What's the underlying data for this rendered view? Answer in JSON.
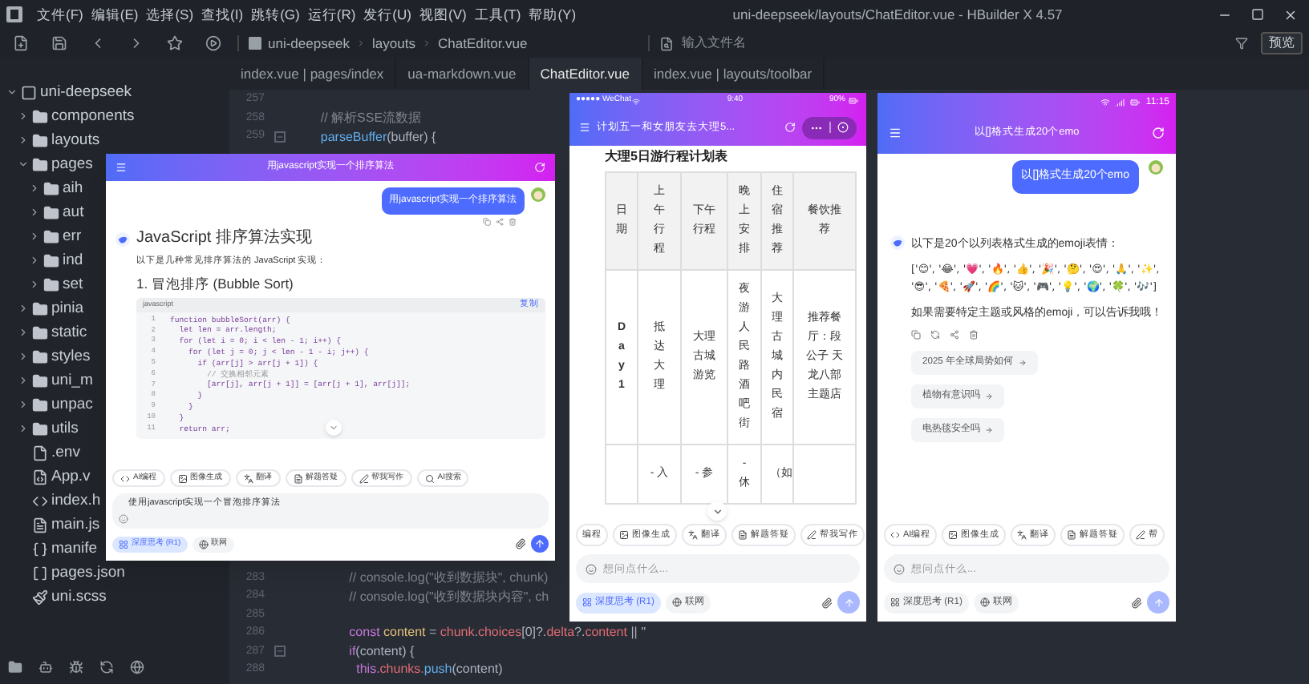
{
  "title_bar": {
    "menus": [
      "文件(F)",
      "编辑(E)",
      "选择(S)",
      "查找(I)",
      "跳转(G)",
      "运行(R)",
      "发行(U)",
      "视图(V)",
      "工具(T)",
      "帮助(Y)"
    ],
    "title": "uni-deepseek/layouts/ChatEditor.vue - HBuilder X 4.57"
  },
  "toolbar": {
    "breadcrumb": [
      "uni-deepseek",
      "layouts",
      "ChatEditor.vue"
    ],
    "file_search": {
      "placeholder": "输入文件名"
    },
    "preview_button": "预览"
  },
  "file_tree": [
    {
      "name": "uni-deepseek",
      "kind": "project",
      "expanded": true,
      "children": [
        {
          "name": "components",
          "kind": "folder",
          "expanded": false
        },
        {
          "name": "layouts",
          "kind": "folder",
          "expanded": false
        },
        {
          "name": "pages",
          "kind": "folder",
          "expanded": true,
          "children": [
            {
              "name": "aih",
              "kind": "folder",
              "expanded": false
            },
            {
              "name": "aut",
              "kind": "folder",
              "expanded": false
            },
            {
              "name": "err",
              "kind": "folder",
              "expanded": false
            },
            {
              "name": "ind",
              "kind": "folder",
              "expanded": false
            },
            {
              "name": "set",
              "kind": "folder",
              "expanded": false
            }
          ]
        },
        {
          "name": "pinia",
          "kind": "folder",
          "expanded": false
        },
        {
          "name": "static",
          "kind": "folder",
          "expanded": false
        },
        {
          "name": "styles",
          "kind": "folder",
          "expanded": false
        },
        {
          "name": "uni_m",
          "kind": "folder",
          "expanded": false
        },
        {
          "name": "unpac",
          "kind": "folder",
          "expanded": false
        },
        {
          "name": "utils",
          "kind": "folder",
          "expanded": false
        },
        {
          "name": ".env",
          "kind": "file"
        },
        {
          "name": "App.v",
          "kind": "vue"
        },
        {
          "name": "index.h",
          "kind": "html"
        },
        {
          "name": "main.js",
          "kind": "js"
        },
        {
          "name": "manife",
          "kind": "manifest"
        },
        {
          "name": "pages.json",
          "kind": "json"
        },
        {
          "name": "uni.scss",
          "kind": "scss"
        }
      ]
    }
  ],
  "editor_tabs": [
    {
      "label": "index.vue | pages/index",
      "selected": false
    },
    {
      "label": "ua-markdown.vue",
      "selected": false
    },
    {
      "label": "ChatEditor.vue",
      "selected": true
    },
    {
      "label": "index.vue | layouts/toolbar",
      "selected": false
    }
  ],
  "code_top": [
    {
      "number": "257"
    },
    {
      "number": "258",
      "segments": [
        {
          "text": "    // 解析SSE流数据",
          "kind": "comment"
        }
      ]
    },
    {
      "number": "259",
      "foldable": true,
      "segments": [
        {
          "text": "    parseBuffer",
          "kind": "func"
        },
        {
          "text": "(buffer) {",
          "kind": "plain"
        }
      ]
    }
  ],
  "code_bottom": [
    {
      "number": "283",
      "segments": [
        {
          "text": "            // console.log(\"收到数据块\", chunk)",
          "kind": "comment"
        }
      ]
    },
    {
      "number": "284",
      "segments": [
        {
          "text": "            // console.log(\"收到数据块内容\", ch",
          "kind": "comment"
        }
      ]
    },
    {
      "number": "285"
    },
    {
      "number": "286",
      "segments": [
        {
          "text": "            const ",
          "kind": "keyword"
        },
        {
          "text": "content",
          "kind": "var"
        },
        {
          "text": " = ",
          "kind": "plain"
        },
        {
          "text": "chunk",
          "kind": "prop"
        },
        {
          "text": ".",
          "kind": "plain"
        },
        {
          "text": "choices",
          "kind": "prop"
        },
        {
          "text": "[0]?.",
          "kind": "plain"
        },
        {
          "text": "delta",
          "kind": "prop"
        },
        {
          "text": "?.",
          "kind": "plain"
        },
        {
          "text": "content",
          "kind": "prop"
        },
        {
          "text": " || ''",
          "kind": "plain"
        }
      ]
    },
    {
      "number": "287",
      "foldable": true,
      "segments": [
        {
          "text": "            if",
          "kind": "keyword"
        },
        {
          "text": "(content) {",
          "kind": "plain"
        }
      ]
    },
    {
      "number": "288",
      "segments": [
        {
          "text": "              this.",
          "kind": "keyword"
        },
        {
          "text": "chunks.",
          "kind": "prop"
        },
        {
          "text": "push",
          "kind": "func"
        },
        {
          "text": "(content)",
          "kind": "plain"
        }
      ]
    }
  ],
  "web_preview": {
    "title": "用javascript实现一个排序算法",
    "user_message": "用javascript实现一个排序算法",
    "heading": "JavaScript 排序算法实现",
    "intro": "以下是几种常见排序算法的 JavaScript 实现：",
    "subheading": "1. 冒泡排序 (Bubble Sort)",
    "code_block": {
      "language": "javascript",
      "copy_label": "复制",
      "lines": [
        {
          "number": "1",
          "text": "function bubbleSort(arr) {"
        },
        {
          "number": "2",
          "text": "  let len = arr.length;"
        },
        {
          "number": "3",
          "text": "  for (let i = 0; i < len - 1; i++) {"
        },
        {
          "number": "4",
          "text": "    for (let j = 0; j < len - 1 - i; j++) {"
        },
        {
          "number": "5",
          "text": "      if (arr[j] > arr[j + 1]) {"
        },
        {
          "number": "6",
          "text": "        // 交换相邻元素"
        },
        {
          "number": "7",
          "text": "        [arr[j], arr[j + 1]] = [arr[j + 1], arr[j]];"
        },
        {
          "number": "8",
          "text": "      }"
        },
        {
          "number": "9",
          "text": "    }"
        },
        {
          "number": "10",
          "text": "  }"
        },
        {
          "number": "11",
          "text": "  return arr;"
        }
      ]
    },
    "chips": [
      {
        "label": "AI编程",
        "kind": "code"
      },
      {
        "label": "图像生成",
        "kind": "image"
      },
      {
        "label": "翻译",
        "kind": "translate"
      },
      {
        "label": "解题答疑",
        "kind": "homework"
      },
      {
        "label": "帮我写作",
        "kind": "write"
      },
      {
        "label": "AI搜索",
        "kind": "search"
      }
    ],
    "input": {
      "value": "使用javascript实现一个冒泡排序算法"
    },
    "toggles": [
      {
        "label": "深度思考 (R1)",
        "kind": "think",
        "on": true
      },
      {
        "label": "联网",
        "kind": "web",
        "on": false
      }
    ],
    "send_disabled": false
  },
  "wechat_preview": {
    "status": {
      "carrier": "●●●●● WeChat",
      "time": "9:40",
      "battery": "90%"
    },
    "title": "计划五一和女朋友去大理5...",
    "heading": "大理5日游行程计划表",
    "table": {
      "columns": [
        "日期",
        "上午行程",
        "下午行程",
        "晚上安排",
        "住宿推荐",
        "餐饮推荐"
      ],
      "rows": [
        [
          "Day1",
          "抵达大理",
          "大理古城游览",
          "夜游人民路酒吧街",
          "大理古城内民宿",
          "推荐餐厅：段公子 天龙八部主题店"
        ],
        [
          "",
          "- 入",
          "- 参",
          "- 休",
          "（如",
          ""
        ]
      ]
    },
    "chips": [
      {
        "label": "编程",
        "kind": "partial"
      },
      {
        "label": "图像生成",
        "kind": "image"
      },
      {
        "label": "翻译",
        "kind": "translate"
      },
      {
        "label": "解题答疑",
        "kind": "homework"
      },
      {
        "label": "帮我写作",
        "kind": "write"
      }
    ],
    "input": {
      "placeholder": "想问点什么..."
    },
    "toggles": [
      {
        "label": "深度思考 (R1)",
        "kind": "think",
        "on": true
      },
      {
        "label": "联网",
        "kind": "web",
        "on": false
      }
    ],
    "send_disabled": true
  },
  "app_preview": {
    "status": {
      "time": "11:15"
    },
    "title": "以[]格式生成20个emo",
    "user_message": "以[]格式生成20个emo",
    "reply": {
      "intro": "以下是20个以列表格式生成的emoji表情：",
      "emoji_list": "['😊', '😂', '💗', '🔥', '👍', '🎉', '🤔', '😍', '🙏', '✨', '😎', '🍕', '🚀', '🌈', '🐱', '🎮', '💡', '🌍', '🍀', '🎶']",
      "outro": "如果需要特定主题或风格的emoji，可以告诉我哦！"
    },
    "suggestions": [
      "2025 年全球局势如何",
      "植物有意识吗",
      "电热毯安全吗"
    ],
    "chips": [
      {
        "label": "AI编程",
        "kind": "code"
      },
      {
        "label": "图像生成",
        "kind": "image"
      },
      {
        "label": "翻译",
        "kind": "translate"
      },
      {
        "label": "解题答疑",
        "kind": "homework"
      },
      {
        "label": "帮",
        "kind": "write"
      }
    ],
    "input": {
      "placeholder": "想问点什么..."
    },
    "toggles": [
      {
        "label": "深度思考 (R1)",
        "kind": "think",
        "on": false
      },
      {
        "label": "联网",
        "kind": "web",
        "on": false
      }
    ],
    "send_disabled": true
  }
}
